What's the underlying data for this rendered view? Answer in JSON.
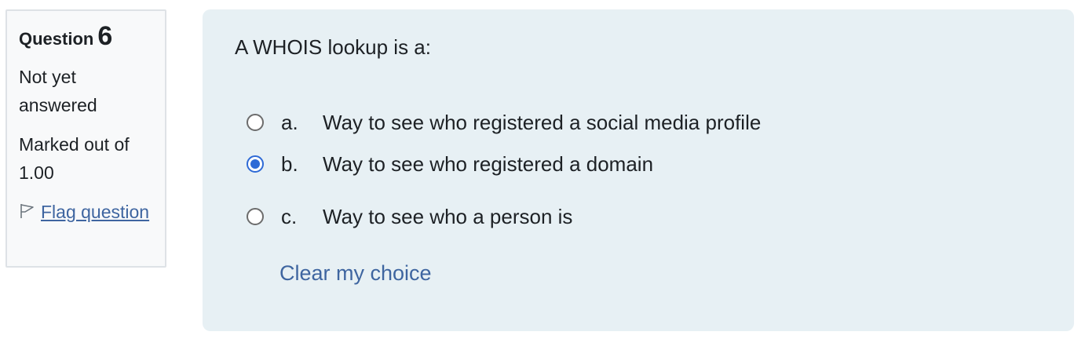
{
  "info": {
    "question_label": "Question",
    "question_number": "6",
    "state": "Not yet answered",
    "grade": "Marked out of 1.00",
    "flag_label": "Flag question"
  },
  "question": {
    "text": "A WHOIS lookup is a:",
    "answers": [
      {
        "letter": "a.",
        "text": "Way to see who registered a social media profile",
        "selected": false
      },
      {
        "letter": "b.",
        "text": "Way to see who registered a domain",
        "selected": true
      },
      {
        "letter": "c.",
        "text": "Way to see who a person is",
        "selected": false
      }
    ],
    "clear_label": "Clear my choice"
  },
  "colors": {
    "content_bg": "#e7f0f4",
    "link": "#3e65a0",
    "radio_selected": "#2e6ad6"
  },
  "icons": {
    "flag": "flag-icon"
  }
}
